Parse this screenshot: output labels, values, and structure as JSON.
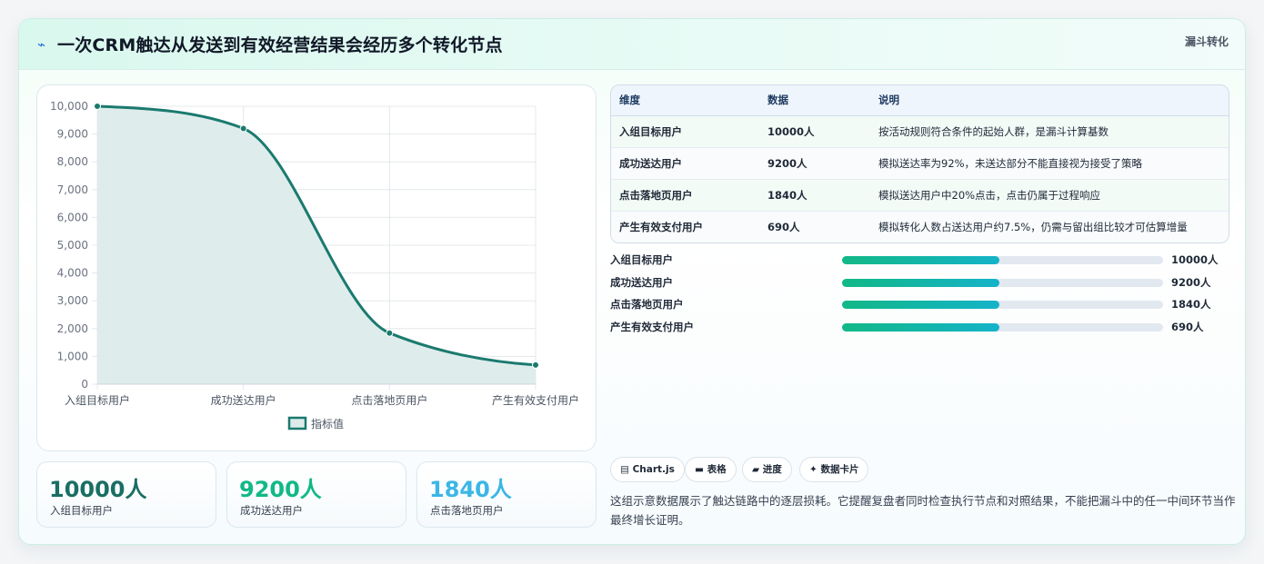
{
  "header": {
    "icon": "lightning-icon",
    "title": "一次CRM触达从发送到有效经营结果会经历多个转化节点",
    "badge": "漏斗转化"
  },
  "chart_data": {
    "type": "line",
    "categories": [
      "入组目标用户",
      "成功送达用户",
      "点击落地页用户",
      "产生有效支付用户"
    ],
    "series": [
      {
        "name": "指标值",
        "values": [
          10000,
          9200,
          1840,
          690
        ]
      }
    ],
    "yticks": [
      "0",
      "1,000",
      "2,000",
      "3,000",
      "4,000",
      "5,000",
      "6,000",
      "7,000",
      "8,000",
      "9,000",
      "10,000"
    ],
    "ylim": [
      0,
      10000
    ],
    "grid": true,
    "legend": "bottom",
    "colors": {
      "line": "#1a7a6e",
      "fill": "#dcebea"
    }
  },
  "table": {
    "headers": [
      "维度",
      "数据",
      "说明"
    ],
    "rows": [
      [
        "入组目标用户",
        "10000人",
        "按活动规则符合条件的起始人群，是漏斗计算基数"
      ],
      [
        "成功送达用户",
        "9200人",
        "模拟送达率为92%，未送达部分不能直接视为接受了策略"
      ],
      [
        "点击落地页用户",
        "1840人",
        "模拟送达用户中20%点击，点击仍属于过程响应"
      ],
      [
        "产生有效支付用户",
        "690人",
        "模拟转化人数占送达用户约7.5%，仍需与留出组比较才可估算增量"
      ]
    ]
  },
  "progress": [
    {
      "label": "入组目标用户",
      "value": "10000人",
      "fraction": 0.49
    },
    {
      "label": "成功送达用户",
      "value": "9200人",
      "fraction": 0.49
    },
    {
      "label": "点击落地页用户",
      "value": "1840人",
      "fraction": 0.49
    },
    {
      "label": "产生有效支付用户",
      "value": "690人",
      "fraction": 0.49
    }
  ],
  "stats": [
    {
      "value": "10000人",
      "label": "入组目标用户",
      "color": "#1a6e63"
    },
    {
      "value": "9200人",
      "label": "成功送达用户",
      "color": "#12b886"
    },
    {
      "value": "1840人",
      "label": "点击落地页用户",
      "color": "#3bb6e6"
    }
  ],
  "tags": [
    {
      "icon": "chart-icon",
      "glyph": "▤",
      "label": "Chart.js"
    },
    {
      "icon": "table-icon",
      "glyph": "▬",
      "label": "表格"
    },
    {
      "icon": "progress-icon",
      "glyph": "▰",
      "label": "进度"
    },
    {
      "icon": "sparkle-icon",
      "glyph": "✦",
      "label": "数据卡片"
    }
  ],
  "note": "这组示意数据展示了触达链路中的逐层损耗。它提醒复盘者同时检查执行节点和对照结果，不能把漏斗中的任一中间环节当作最终增长证明。"
}
